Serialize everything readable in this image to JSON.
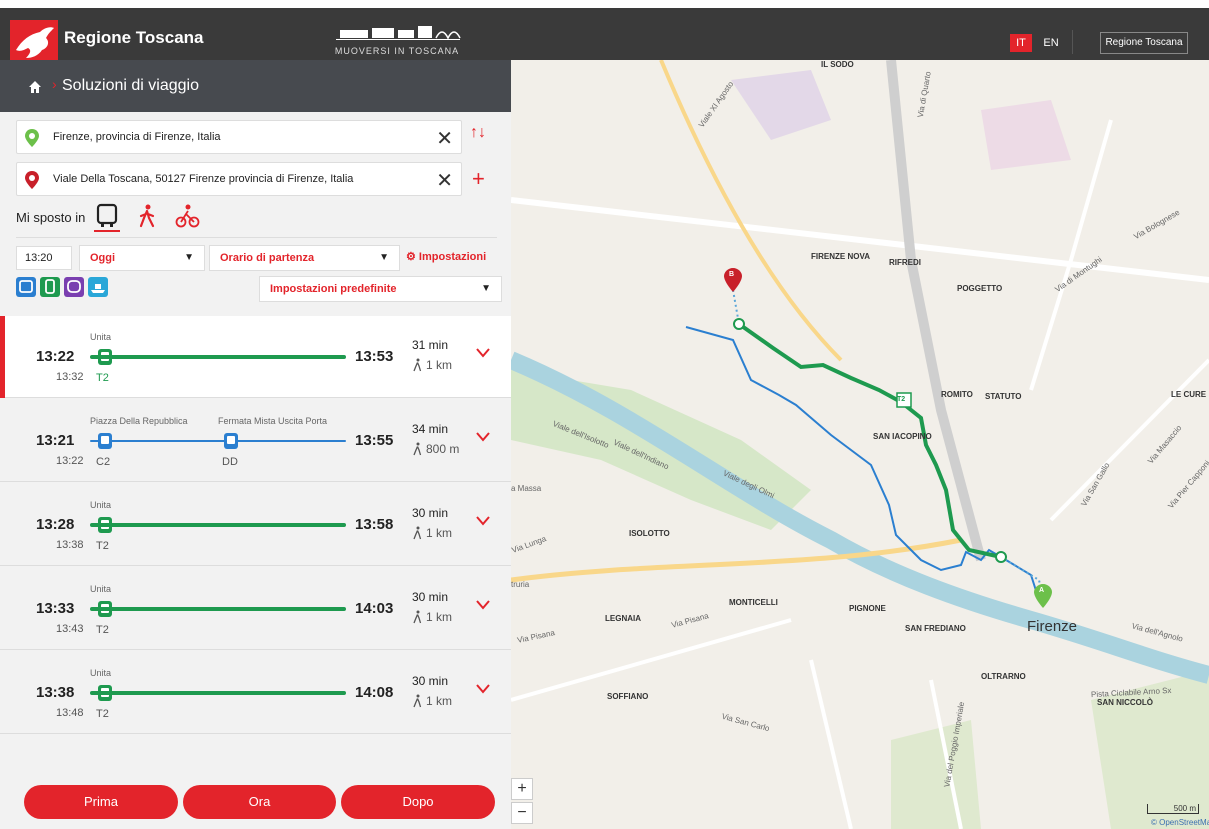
{
  "header": {
    "brand": "Regione Toscana",
    "center_logo": "MUOVERSI IN TOSCANA",
    "lang_it": "IT",
    "lang_en": "EN",
    "region_button": "Regione Toscana"
  },
  "subheader": {
    "title": "Soluzioni di viaggio"
  },
  "form": {
    "origin": "Firenze, provincia di Firenze, Italia",
    "destination": "Viale Della Toscana, 50127 Firenze provincia di Firenze, Italia",
    "mode_label": "Mi sposto in",
    "time": "13:20",
    "day": "Oggi",
    "time_mode": "Orario di partenza",
    "settings": "Impostazioni",
    "preset": "Impostazioni predefinite"
  },
  "results": [
    {
      "dep": "13:22",
      "arr": "13:53",
      "sub": "13:32",
      "line": "T2",
      "stop1": "Unita",
      "duration": "31 min",
      "walk": "1 km"
    },
    {
      "dep": "13:21",
      "arr": "13:55",
      "sub": "13:22",
      "line": "C2",
      "line2": "DD",
      "stop1": "Piazza Della Repubblica",
      "stop2": "Fermata Mista Uscita Porta",
      "duration": "34 min",
      "walk": "800 m"
    },
    {
      "dep": "13:28",
      "arr": "13:58",
      "sub": "13:38",
      "line": "T2",
      "stop1": "Unita",
      "duration": "30 min",
      "walk": "1 km"
    },
    {
      "dep": "13:33",
      "arr": "14:03",
      "sub": "13:43",
      "line": "T2",
      "stop1": "Unita",
      "duration": "30 min",
      "walk": "1 km"
    },
    {
      "dep": "13:38",
      "arr": "14:08",
      "sub": "13:48",
      "line": "T2",
      "stop1": "Unita",
      "duration": "30 min",
      "walk": "1 km"
    }
  ],
  "buttons": {
    "prev": "Prima",
    "now": "Ora",
    "next": "Dopo"
  },
  "map": {
    "labels": {
      "il_sodo": "IL SODO",
      "firenze_nova": "FIRENZE NOVA",
      "rifredi": "RIFREDI",
      "poggetto": "POGGETTO",
      "romito": "ROMITO",
      "statuto": "STATUTO",
      "le_cure": "LE CURE",
      "san_iacopino": "SAN IACOPINO",
      "isolotto": "ISOLOTTO",
      "monticelli": "MONTICELLI",
      "pignone": "PIGNONE",
      "legnaia": "LEGNAIA",
      "san_frediano": "SAN FREDIANO",
      "oltrarno": "OLTRARNO",
      "soffiano": "SOFFIANO",
      "san_niccolo": "SAN NICCOLÒ",
      "firenze": "Firenze",
      "viale_xi_agosto": "Viale XI Agosto",
      "via_di_quarto": "Via di Quarto",
      "via_bolognese": "Via Bolognese",
      "via_di_montughi": "Via di Montughi",
      "viale_dell_indiano": "Viale dell'Indiano",
      "viale_degli_olmi": "Viale degli Olmi",
      "viale_dell_isolotto": "Viale dell'Isolotto",
      "via_pisana": "Via Pisana",
      "via_pisana_2": "Via Pisana",
      "via_san_carlo": "Via San Carlo",
      "via_san_gallo": "Via San Gallo",
      "via_masaccio": "Via Masaccio",
      "via_piero_capponi": "Via Pier Capponi",
      "viale_del_poggio": "Via del Poggio Imperiale",
      "via_dell_agnolo": "Via dell'Agnolo",
      "pista_ciclabile": "Pista Ciclabile Arno Sx",
      "via_massa": "a Massa",
      "via_etruria": "truria",
      "via_lunga": "Via Lunga",
      "tram_label": "T2",
      "marker_a": "A",
      "marker_b": "B"
    },
    "zoom_in": "+",
    "zoom_out": "−",
    "scale": "500 m",
    "attribution": "© OpenStreetMap",
    "colors": {
      "tram": "#1e9a4f",
      "bus": "#2b7fd0",
      "river": "#aad3df",
      "accent": "#e3242b"
    }
  }
}
